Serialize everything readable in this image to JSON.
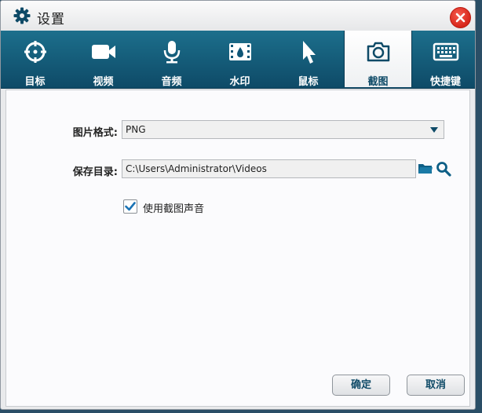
{
  "window": {
    "title": "设置"
  },
  "tabs": [
    {
      "label": "目标",
      "icon": "target-icon"
    },
    {
      "label": "视频",
      "icon": "video-camera-icon"
    },
    {
      "label": "音频",
      "icon": "microphone-icon"
    },
    {
      "label": "水印",
      "icon": "watermark-icon"
    },
    {
      "label": "鼠标",
      "icon": "mouse-pointer-icon"
    },
    {
      "label": "截图",
      "icon": "camera-icon",
      "active": true
    },
    {
      "label": "快捷键",
      "icon": "keyboard-icon"
    }
  ],
  "form": {
    "format_label": "图片格式:",
    "format_value": "PNG",
    "dir_label": "保存目录:",
    "dir_value": "C:\\Users\\Administrator\\Videos",
    "sound_label": "使用截图声音",
    "sound_checked": true
  },
  "buttons": {
    "ok": "确定",
    "cancel": "取消"
  },
  "colors": {
    "accent": "#0e4a67",
    "tabbar": "#1c6f8c",
    "close": "#d7261b"
  }
}
